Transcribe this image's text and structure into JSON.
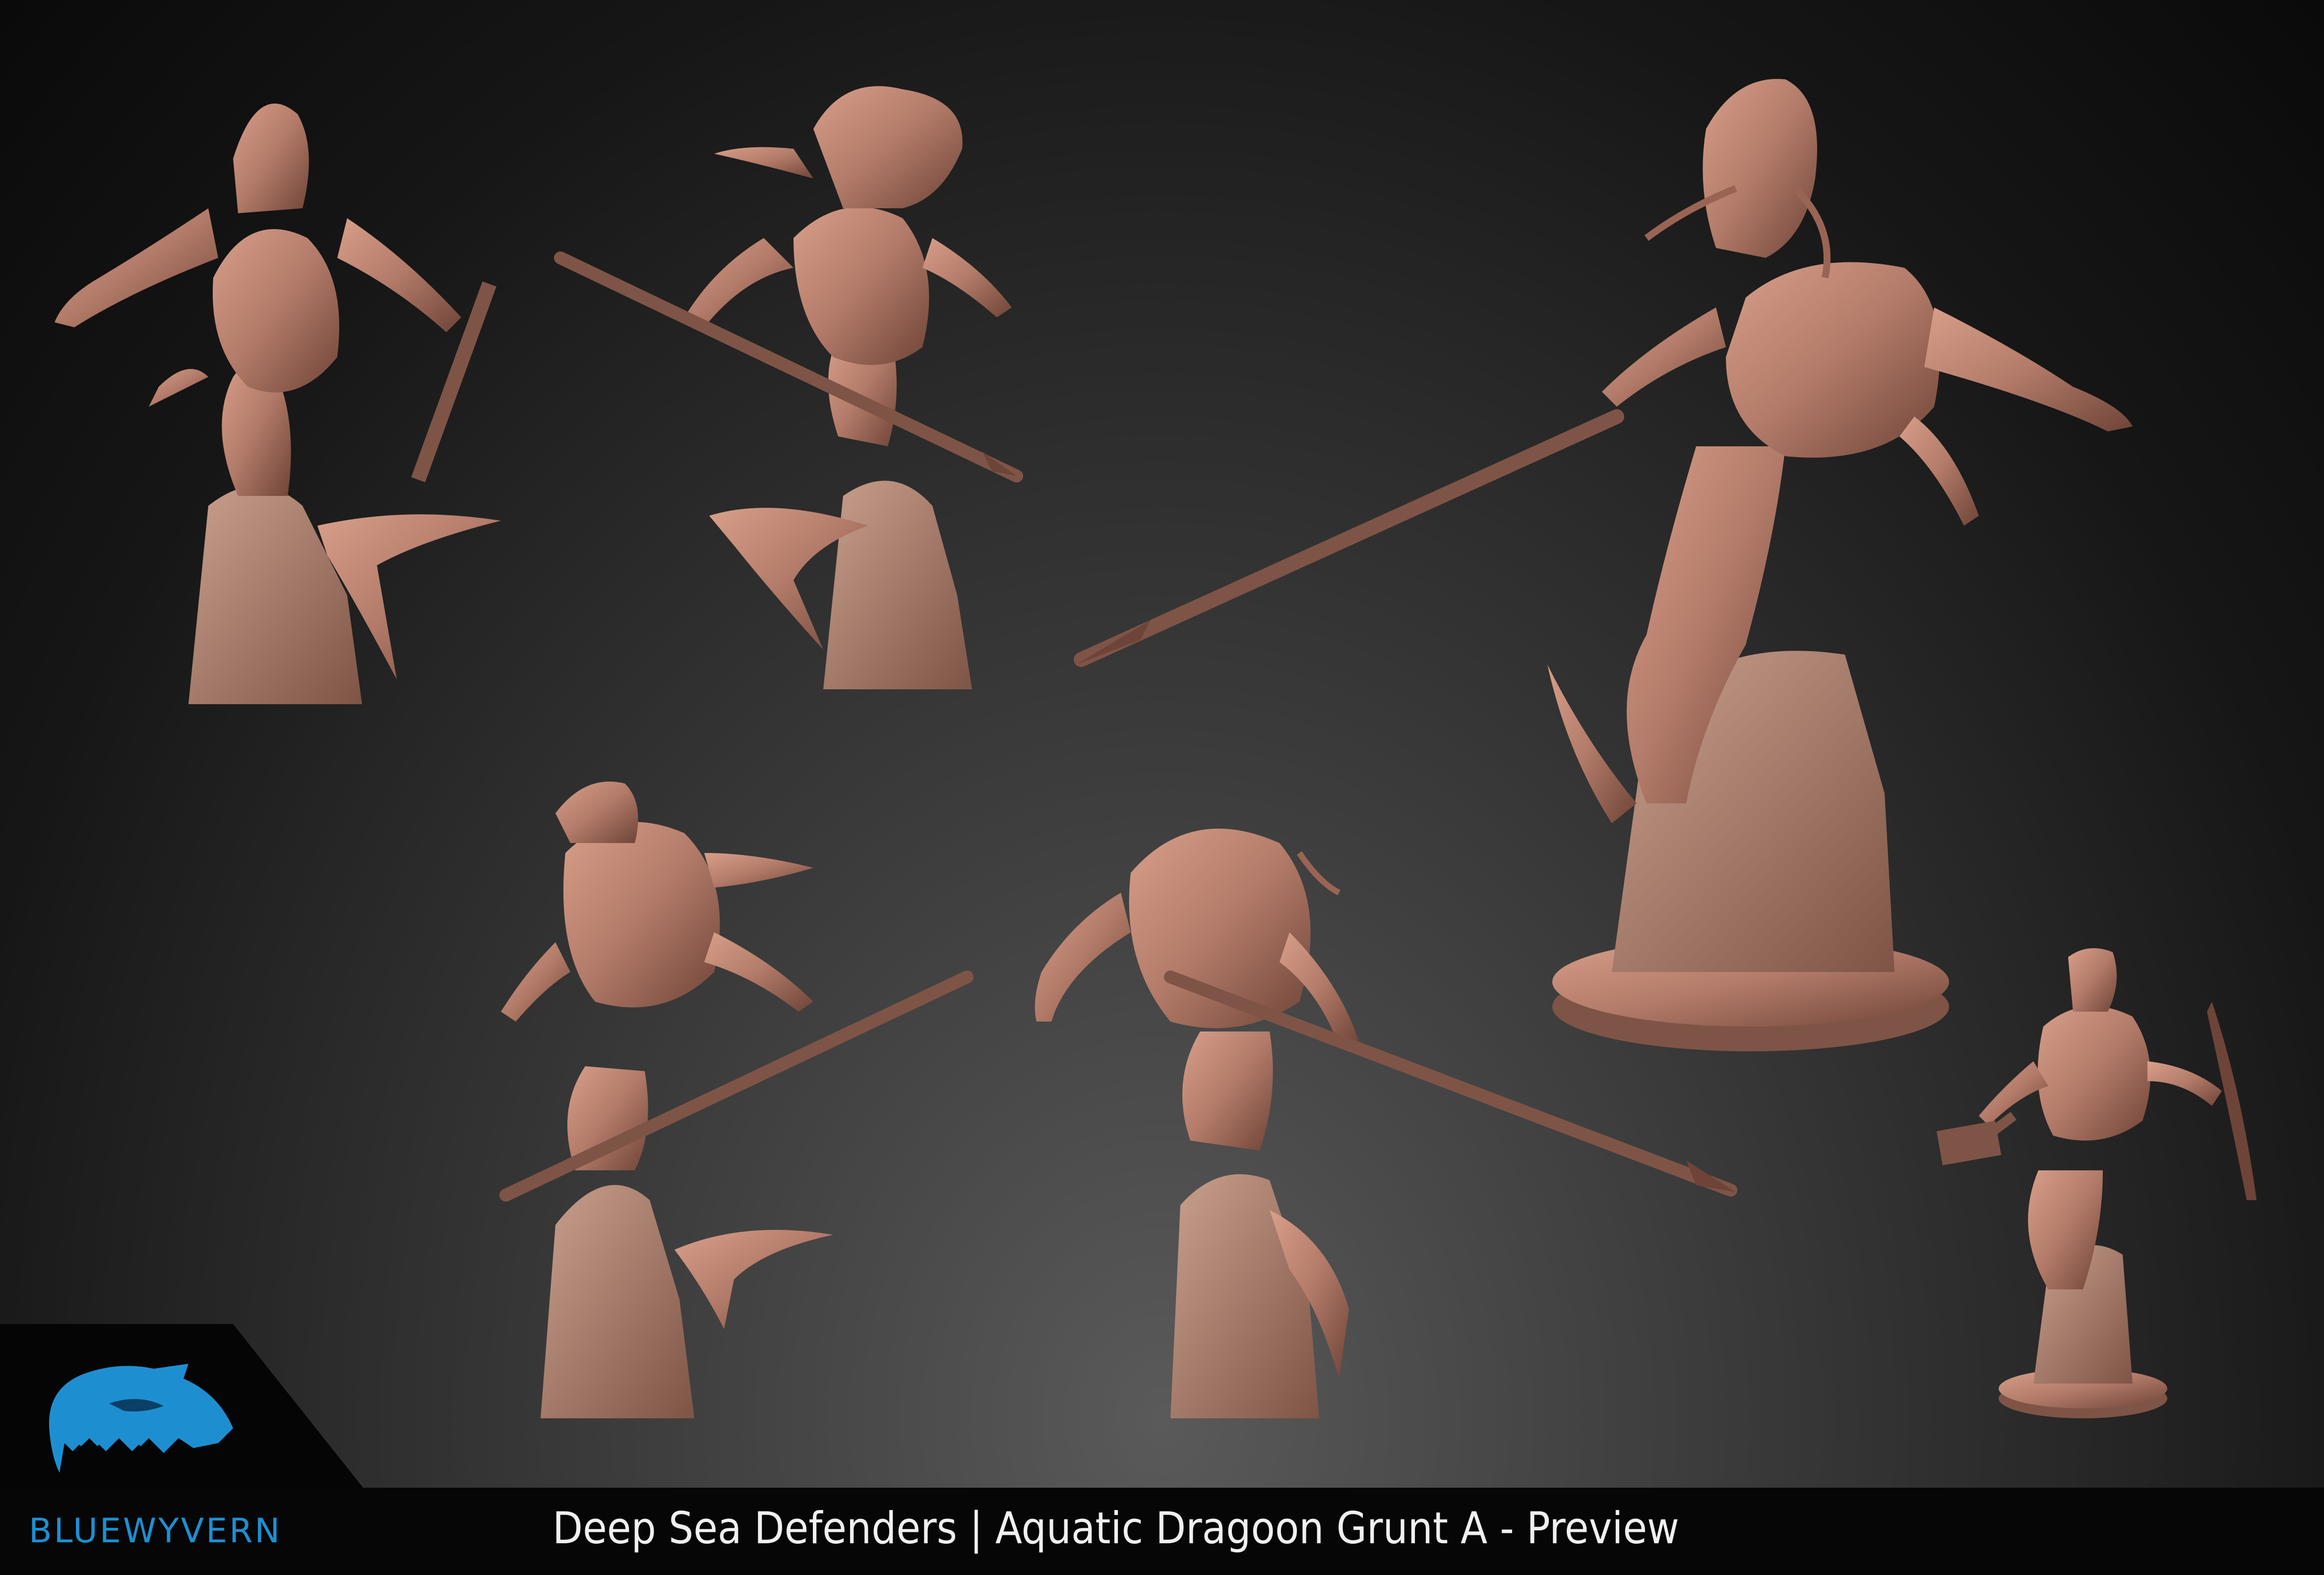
{
  "caption": "Deep Sea Defenders | Aquatic Dragoon Grunt A - Preview",
  "brand": {
    "name": "BLUEWYVERN",
    "accent": "#1d8fd1"
  },
  "model": {
    "clay_color": "#b27a68",
    "shadow_color": "#6e4438"
  },
  "views": [
    "view-back-three-quarter",
    "view-front-spear",
    "view-hero-front",
    "view-back-left",
    "view-back-right",
    "view-small-front-weapons"
  ]
}
